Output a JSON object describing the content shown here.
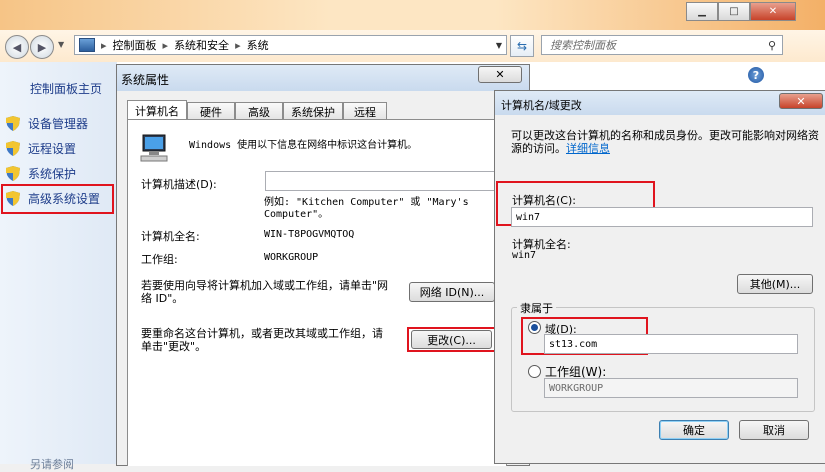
{
  "explorer": {
    "breadcrumb": [
      "控制面板",
      "系统和安全",
      "系统"
    ],
    "search_placeholder": "搜索控制面板",
    "sidebar": {
      "home": "控制面板主页",
      "items": [
        "设备管理器",
        "远程设置",
        "系统保护",
        "高级系统设置"
      ],
      "bottom_text": "另请参阅"
    }
  },
  "sysprops": {
    "title": "系统属性",
    "tabs": [
      "计算机名",
      "硬件",
      "高级",
      "系统保护",
      "远程"
    ],
    "intro": "Windows 使用以下信息在网络中标识这台计算机。",
    "desc_label": "计算机描述(D):",
    "desc_value": "",
    "example": "例如: \"Kitchen Computer\" 或 \"Mary's Computer\"。",
    "fullname_label": "计算机全名:",
    "fullname_value": "WIN-T8POGVMQTOQ",
    "workgroup_label": "工作组:",
    "workgroup_value": "WORKGROUP",
    "wizard_text": "若要使用向导将计算机加入域或工作组，请单击\"网络 ID\"。",
    "network_id_button": "网络 ID(N)...",
    "rename_text": "要重命名这台计算机，或者更改其域或工作组，请单击\"更改\"。",
    "change_button": "更改(C)..."
  },
  "change_dialog": {
    "title": "计算机名/域更改",
    "intro": "可以更改这台计算机的名称和成员身份。更改可能影响对网络资源的访问。",
    "details_link": "详细信息",
    "name_label": "计算机名(C):",
    "name_value": "win7",
    "fullname_label": "计算机全名:",
    "fullname_value": "win7",
    "more_button": "其他(M)...",
    "member_of": "隶属于",
    "domain_label": "域(D):",
    "domain_value": "st13.com",
    "workgroup_label": "工作组(W):",
    "workgroup_value": "WORKGROUP",
    "ok_button": "确定",
    "cancel_button": "取消",
    "domain_selected": true
  },
  "colors": {
    "highlight": "#e0141e",
    "link": "#0066cc"
  }
}
